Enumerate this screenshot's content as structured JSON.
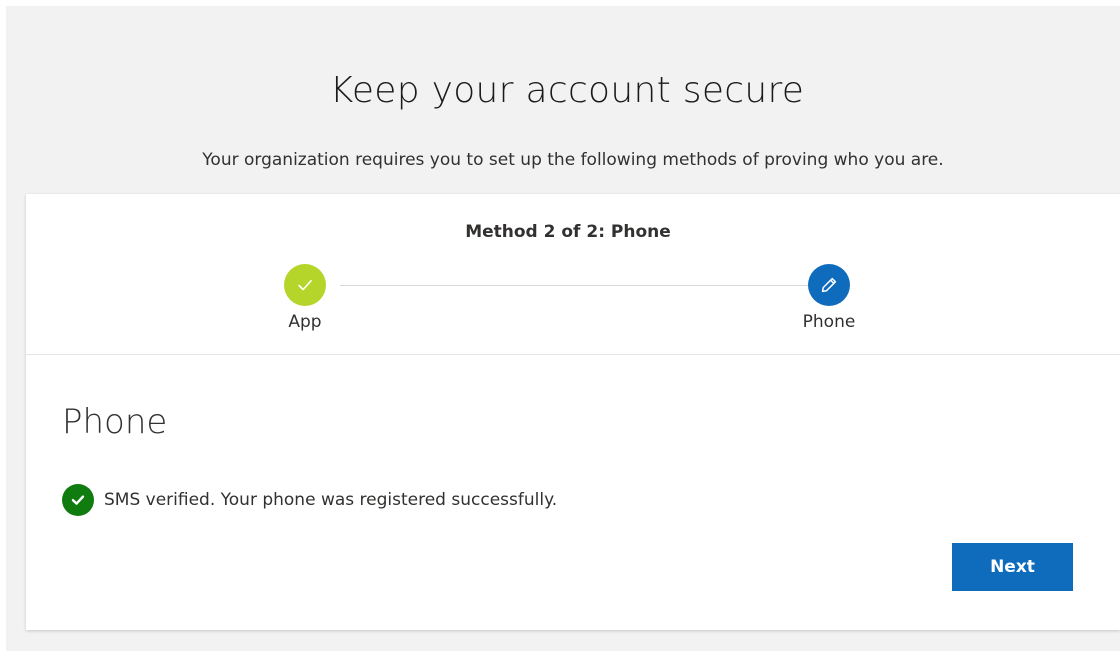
{
  "header": {
    "title": "Keep your account secure",
    "subtitle": "Your organization requires you to set up the following methods of proving who you are."
  },
  "progress": {
    "label": "Method 2 of 2: Phone",
    "steps": [
      {
        "label": "App",
        "state": "complete",
        "icon": "checkmark-icon",
        "color": "#b5d52a"
      },
      {
        "label": "Phone",
        "state": "current",
        "icon": "pencil-icon",
        "color": "#0f6cbd"
      }
    ]
  },
  "section": {
    "title": "Phone",
    "status": {
      "icon": "success-check-icon",
      "color": "#107c10",
      "text": "SMS verified. Your phone was registered successfully."
    }
  },
  "actions": {
    "next_label": "Next",
    "accent_color": "#0f6cbd"
  }
}
